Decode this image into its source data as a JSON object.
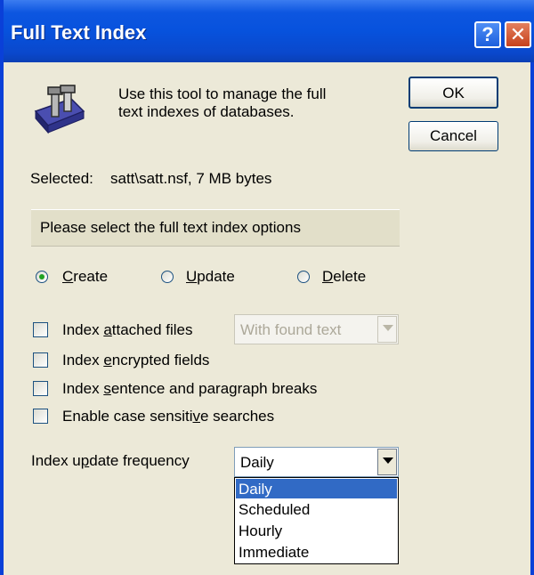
{
  "window": {
    "title": "Full Text Index",
    "help_label": "?",
    "close_label": "✕"
  },
  "intro": {
    "line1": "Use this tool to manage the full",
    "line2": "text indexes of databases.",
    "icon": "database-tool-icon"
  },
  "buttons": {
    "ok": "OK",
    "cancel": "Cancel"
  },
  "selected": {
    "label": "Selected:",
    "value": "satt\\satt.nsf, 7 MB bytes"
  },
  "options_header": "Please select the full text index options",
  "action": {
    "create": {
      "pre": "",
      "key": "C",
      "post": "reate"
    },
    "update": {
      "pre": "",
      "key": "U",
      "post": "pdate"
    },
    "delete": {
      "pre": "",
      "key": "D",
      "post": "elete"
    },
    "selected": "create"
  },
  "checkboxes": {
    "attached": {
      "pre": "Index ",
      "key": "a",
      "post": "ttached files",
      "checked": false
    },
    "encrypted": {
      "pre": "Index ",
      "key": "e",
      "post": "ncrypted fields",
      "checked": false
    },
    "sentence": {
      "pre": "Index ",
      "key": "s",
      "post": "entence and paragraph breaks",
      "checked": false
    },
    "case": {
      "pre": "Enable case sensiti",
      "key": "v",
      "post": "e searches",
      "checked": false
    }
  },
  "attached_mode": {
    "value": "With found text",
    "enabled": false
  },
  "frequency": {
    "label_pre": "Index u",
    "label_key": "p",
    "label_post": "date frequency",
    "value": "Daily",
    "options": [
      "Daily",
      "Scheduled",
      "Hourly",
      "Immediate"
    ],
    "highlighted": "Daily"
  },
  "colors": {
    "titlebar": "#0752dd",
    "dialog_bg": "#ece9d8",
    "header_bg": "#e2dfc9",
    "highlight": "#316ac5",
    "radio_dot": "#21a121"
  }
}
